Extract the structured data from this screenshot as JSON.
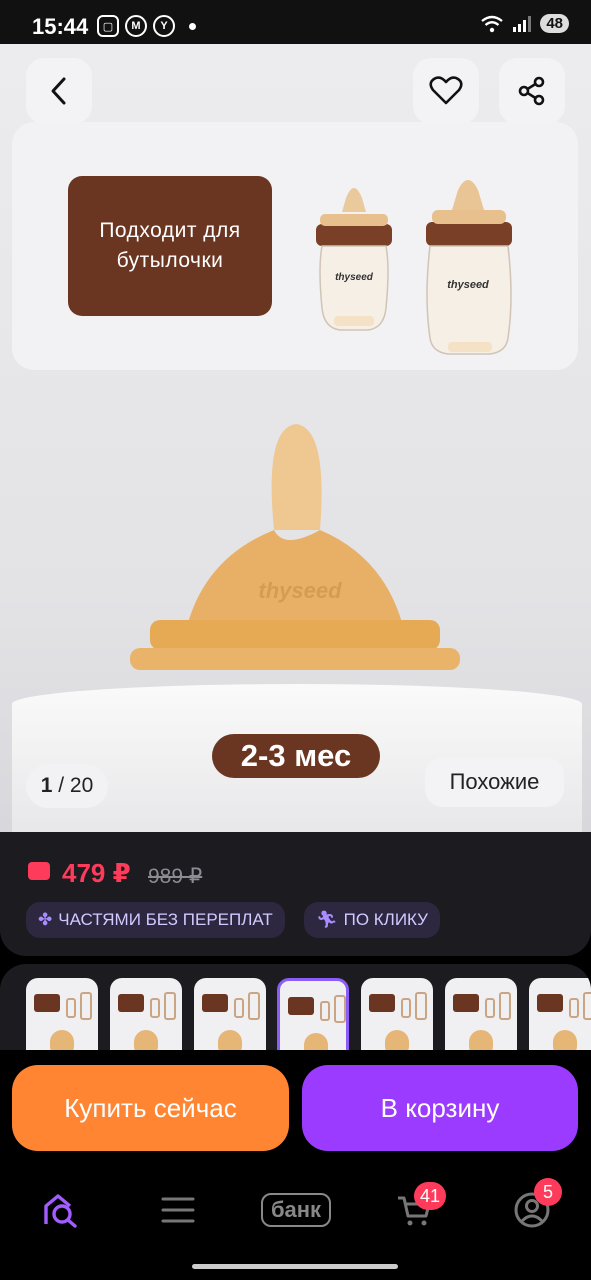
{
  "status_bar": {
    "time": "15:44",
    "battery": "48",
    "network": "5"
  },
  "gallery": {
    "banner_label": "Подходит для бутылочки",
    "brand": "thyseed",
    "age_badge": "2-3 мес",
    "counter_current": "1",
    "counter_total": "/ 20",
    "similar_label": "Похожие"
  },
  "price": {
    "current": "479 ₽",
    "old": "989 ₽",
    "chips": [
      {
        "icon": "installments-icon",
        "label": "ЧАСТЯМИ БЕЗ ПЕРЕПЛАТ"
      },
      {
        "icon": "running-person-icon",
        "label": "ПО КЛИКУ"
      }
    ]
  },
  "thumbnails": {
    "count": 7,
    "selected_index": 3
  },
  "actions": {
    "buy_now": "Купить сейчас",
    "add_to_cart": "В корзину"
  },
  "bottom_nav": {
    "bank_label": "банк",
    "cart_badge": "41",
    "profile_badge": "5"
  },
  "colors": {
    "accent_purple": "#9b3bff",
    "accent_orange": "#ff8533",
    "price_red": "#ff3b5c",
    "brand_brown": "#6b3621"
  }
}
